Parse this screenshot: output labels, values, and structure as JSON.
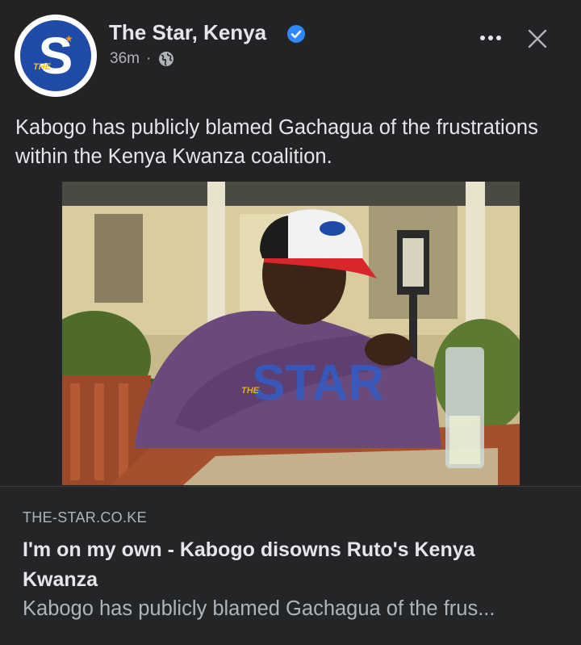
{
  "post": {
    "page_name": "The Star, Kenya",
    "verified_icon": "verified-badge-icon",
    "timestamp": "36m",
    "separator": "·",
    "audience_icon": "globe-icon",
    "more_icon": "more-options-icon",
    "close_icon": "close-icon",
    "text": "Kabogo has publicly blamed Gachagua of the frustrations within the Kenya Kwanza coalition."
  },
  "avatar": {
    "letter": "S",
    "small_text": "THE",
    "brand_color": "#1f4aa8"
  },
  "photo": {
    "watermark": "STAR",
    "watermark_small": "THE"
  },
  "link_preview": {
    "domain": "THE-STAR.CO.KE",
    "title": "I'm on my own - Kabogo disowns Ruto's Kenya Kwanza",
    "description": "Kabogo has publicly blamed Gachagua of the frus..."
  },
  "colors": {
    "background": "#232325",
    "text_primary": "#e4e6eb",
    "text_secondary": "#b0b3b8",
    "verified_blue": "#2d88ff"
  }
}
